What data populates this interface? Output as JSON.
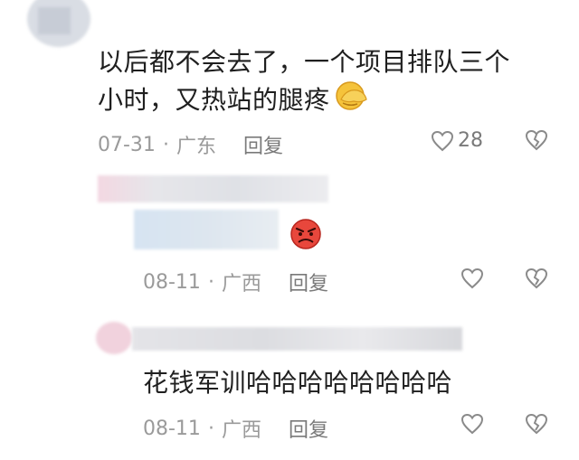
{
  "comments": [
    {
      "text_line1": "以后都不会去了，一个项目排队三个",
      "text_line2": "小时，又热站的腿疼",
      "emoji": "face-palm-emoji",
      "date": "07-31",
      "separator": "·",
      "location": "广东",
      "reply_label": "回复",
      "like_count": "28",
      "like_icon": "heart-outline-icon",
      "dislike_icon": "broken-heart-icon"
    },
    {
      "emoji": "angry-face-emoji",
      "date": "08-11",
      "separator": "·",
      "location": "广西",
      "reply_label": "回复",
      "like_icon": "heart-outline-icon",
      "dislike_icon": "broken-heart-icon"
    },
    {
      "text": "花钱军训哈哈哈哈哈哈哈哈",
      "date": "08-11",
      "separator": "·",
      "location": "广西",
      "reply_label": "回复",
      "like_icon": "heart-outline-icon",
      "dislike_icon": "broken-heart-icon"
    }
  ],
  "colors": {
    "text": "#1f1f1f",
    "meta": "#9a9a9a",
    "emoji_yellow": "#f5c33b",
    "emoji_red": "#e8473c"
  }
}
